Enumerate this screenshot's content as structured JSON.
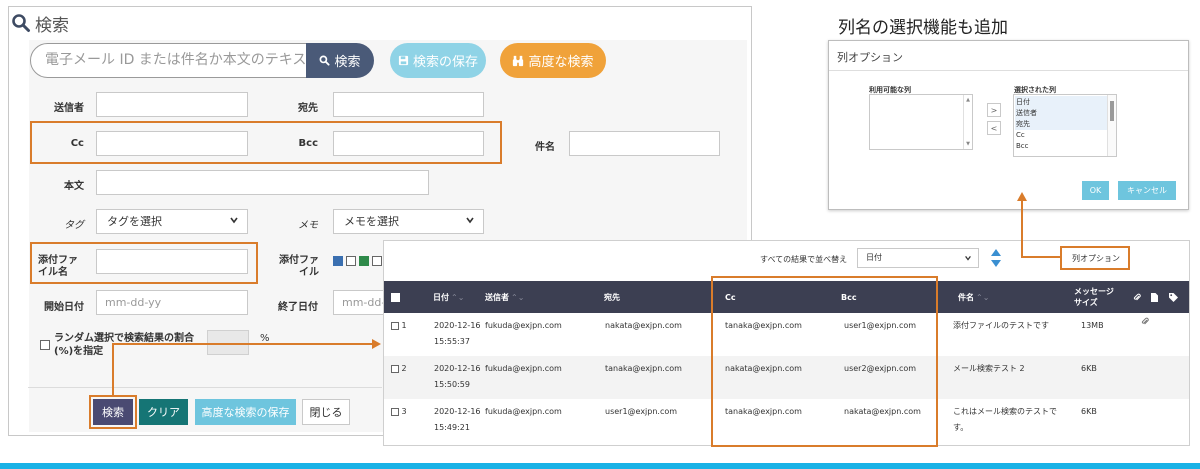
{
  "search": {
    "title": "検索",
    "query_placeholder": "電子メール ID または件名か本文のテキス",
    "search_btn": "検索",
    "save_search_btn": "検索の保存",
    "advanced_btn": "高度な検索",
    "labels": {
      "from": "送信者",
      "to": "宛先",
      "cc": "Cc",
      "bcc": "Bcc",
      "subject": "件名",
      "body": "本文",
      "tag": "タグ",
      "memo": "メモ",
      "attachment_name": "添付ファ\nイル名",
      "attachment_file": "添付ファ\nイル",
      "start_date": "開始日付",
      "end_date": "終了日付",
      "random": "ランダム選択で検索結果の割合 (%)を指定",
      "percent": "%"
    },
    "tag_select": "タグを選択",
    "memo_select": "メモを選択",
    "date_placeholder": "mm-dd-yy",
    "end_date_partial": "mm-dd-y",
    "buttons": {
      "search": "検索",
      "clear": "クリア",
      "save_advanced": "高度な検索の保存",
      "close": "閉じる"
    }
  },
  "column_options": {
    "heading": "列名の選択機能も追加",
    "dialog_title": "列オプション",
    "available_label": "利用可能な列",
    "selected_label": "選択された列",
    "selected_items": [
      "日付",
      "送信者",
      "宛先",
      "Cc",
      "Bcc"
    ],
    "move_right": ">",
    "move_left": "<",
    "ok": "OK",
    "cancel": "キャンセル"
  },
  "results": {
    "sort_label": "すべての結果で並べ替え",
    "sort_value": "日付",
    "column_options_link": "列オプション",
    "headers": {
      "date": "日付",
      "from": "送信者",
      "to": "宛先",
      "cc": "Cc",
      "bcc": "Bcc",
      "subject": "件名",
      "size": "メッセージ\nサイズ"
    },
    "rows": [
      {
        "num": "1",
        "date": "2020-12-16",
        "time": "15:55:37",
        "from": "fukuda@exjpn.com",
        "to": "nakata@exjpn.com",
        "cc": "tanaka@exjpn.com",
        "bcc": "user1@exjpn.com",
        "subject": "添付ファイルのテストです",
        "size": "13MB"
      },
      {
        "num": "2",
        "date": "2020-12-16",
        "time": "15:50:59",
        "from": "fukuda@exjpn.com",
        "to": "tanaka@exjpn.com",
        "cc": "nakata@exjpn.com",
        "bcc": "user2@exjpn.com",
        "subject": "メール検索テスト 2",
        "size": "6KB"
      },
      {
        "num": "3",
        "date": "2020-12-16",
        "time": "15:49:21",
        "from": "fukuda@exjpn.com",
        "to": "user1@exjpn.com",
        "cc": "tanaka@exjpn.com",
        "bcc": "nakata@exjpn.com",
        "subject": "これはメール検索のテストで",
        "subject2": "す。",
        "size": "6KB"
      }
    ]
  },
  "colors": {
    "highlight": "#d97c2b",
    "accent_blue": "#19b2e6",
    "header_dark": "#3c3f52"
  }
}
